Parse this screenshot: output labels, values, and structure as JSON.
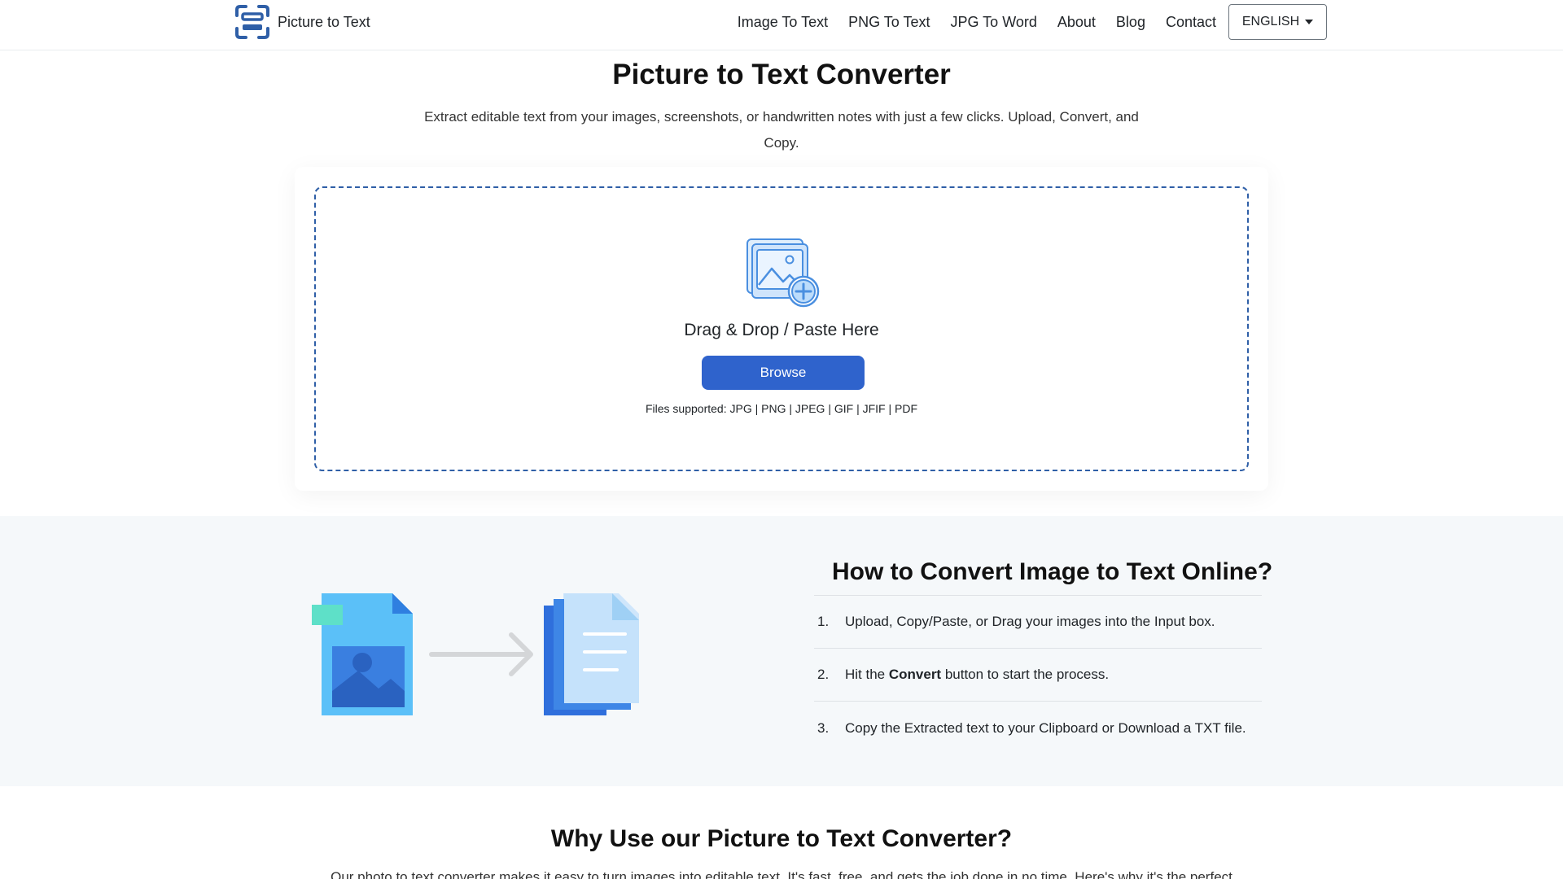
{
  "header": {
    "brand_name": "Picture to Text",
    "nav": [
      {
        "label": "Image To Text"
      },
      {
        "label": "PNG To Text"
      },
      {
        "label": "JPG To Word"
      },
      {
        "label": "About"
      },
      {
        "label": "Blog"
      },
      {
        "label": "Contact"
      }
    ],
    "language": "ENGLISH"
  },
  "hero": {
    "title": "Picture to Text Converter",
    "description": "Extract editable text from your images, screenshots, or handwritten notes with just a few clicks. Upload, Convert, and Copy."
  },
  "upload": {
    "drop_label": "Drag & Drop / Paste Here",
    "browse_label": "Browse",
    "files_supported": "Files supported: JPG | PNG | JPEG | GIF | JFIF | PDF"
  },
  "how": {
    "title": "How to Convert Image to Text Online?",
    "steps": [
      {
        "num": "1.",
        "before": "Upload, Copy/Paste, or Drag your images into the Input box.",
        "bold": "",
        "after": ""
      },
      {
        "num": "2.",
        "before": "Hit the ",
        "bold": "Convert",
        "after": " button to start the process."
      },
      {
        "num": "3.",
        "before": "Copy the Extracted text to your Clipboard or Download a TXT file.",
        "bold": "",
        "after": ""
      }
    ]
  },
  "why": {
    "title": "Why Use our Picture to Text Converter?",
    "description": "Our photo to text converter makes it easy to turn images into editable text. It's fast, free, and gets the job done in no time. Here's why it's the perfect"
  },
  "colors": {
    "primary": "#2f63cc",
    "dashed_border": "#2f5fa7",
    "section_bg": "#f5f8fa"
  }
}
